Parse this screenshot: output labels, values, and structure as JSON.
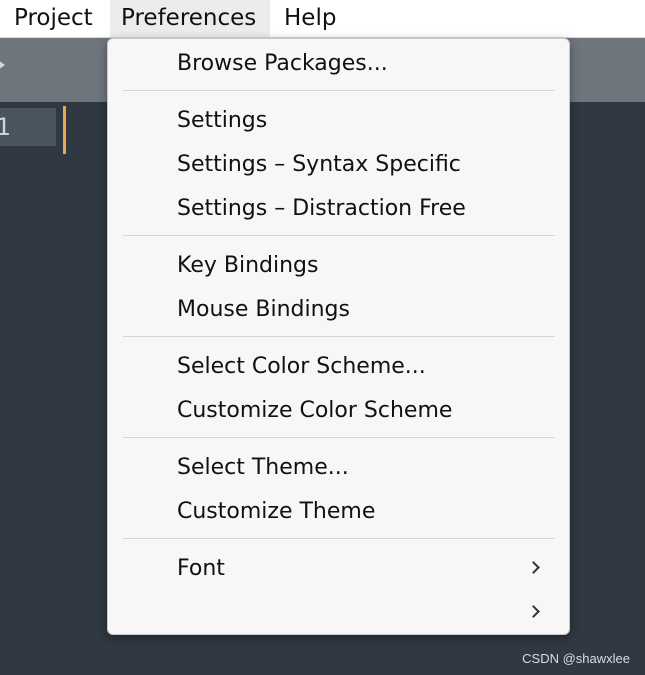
{
  "menubar": {
    "items": [
      {
        "label": "Project"
      },
      {
        "label": "Preferences",
        "active": true
      },
      {
        "label": "Help"
      }
    ]
  },
  "editor": {
    "line_number": "1",
    "caret_color": "#f0a64e",
    "background": "#303841"
  },
  "preferences_menu": {
    "items": [
      {
        "label": "Browse Packages..."
      },
      {
        "label": "Settings"
      },
      {
        "label": "Settings – Syntax Specific"
      },
      {
        "label": "Settings – Distraction Free"
      },
      {
        "label": "Key Bindings"
      },
      {
        "label": "Mouse Bindings"
      },
      {
        "label": "Select Color Scheme..."
      },
      {
        "label": "Customize Color Scheme"
      },
      {
        "label": "Select Theme..."
      },
      {
        "label": "Customize Theme"
      },
      {
        "label": "Font",
        "submenu": true,
        "icon": "chevron-right-icon"
      },
      {
        "label": "",
        "submenu": true,
        "icon": "chevron-right-icon"
      }
    ]
  },
  "watermark": {
    "text": "CSDN @shawxlee"
  }
}
